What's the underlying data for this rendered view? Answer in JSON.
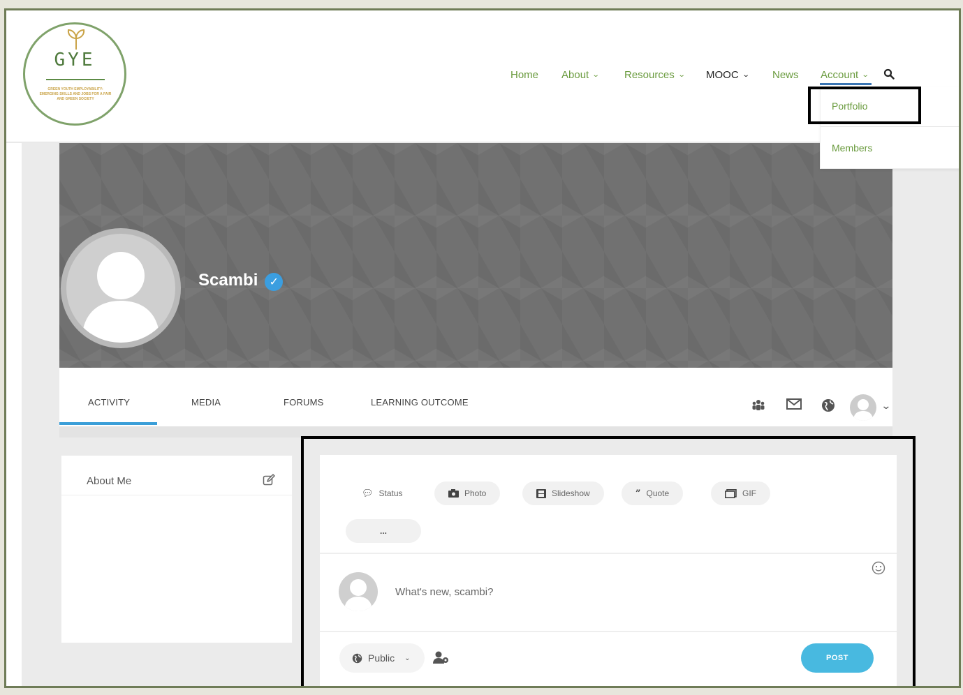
{
  "logo": {
    "title": "GYE",
    "subtitle": "GREEN YOUTH EMPLOYABILITY: EMERGING SKILLS AND JOBS FOR A FAIR AND GREEN SOCIETY"
  },
  "nav": {
    "items": [
      {
        "label": "Home"
      },
      {
        "label": "About"
      },
      {
        "label": "Resources"
      },
      {
        "label": "MOOC"
      },
      {
        "label": "News"
      },
      {
        "label": "Account"
      }
    ],
    "account_menu": [
      "Portfolio",
      "Members"
    ]
  },
  "profile": {
    "name": "Scambi",
    "tabs": [
      "ACTIVITY",
      "MEDIA",
      "FORUMS",
      "LEARNING OUTCOME"
    ],
    "active_tab": "ACTIVITY"
  },
  "about": {
    "title": "About Me"
  },
  "post": {
    "types": [
      {
        "label": "Status",
        "icon": "chat-bubble-icon"
      },
      {
        "label": "Photo",
        "icon": "camera-icon"
      },
      {
        "label": "Slideshow",
        "icon": "film-icon"
      },
      {
        "label": "Quote",
        "icon": "quote-icon"
      },
      {
        "label": "GIF",
        "icon": "gif-icon"
      },
      {
        "label": "...",
        "icon": "more-icon"
      }
    ],
    "placeholder": "What's new, scambi?",
    "privacy": "Public",
    "submit": "POST"
  },
  "colors": {
    "accent_green": "#6a9b3e",
    "accent_blue": "#3a9ed8",
    "post_button": "#48b9e0"
  }
}
